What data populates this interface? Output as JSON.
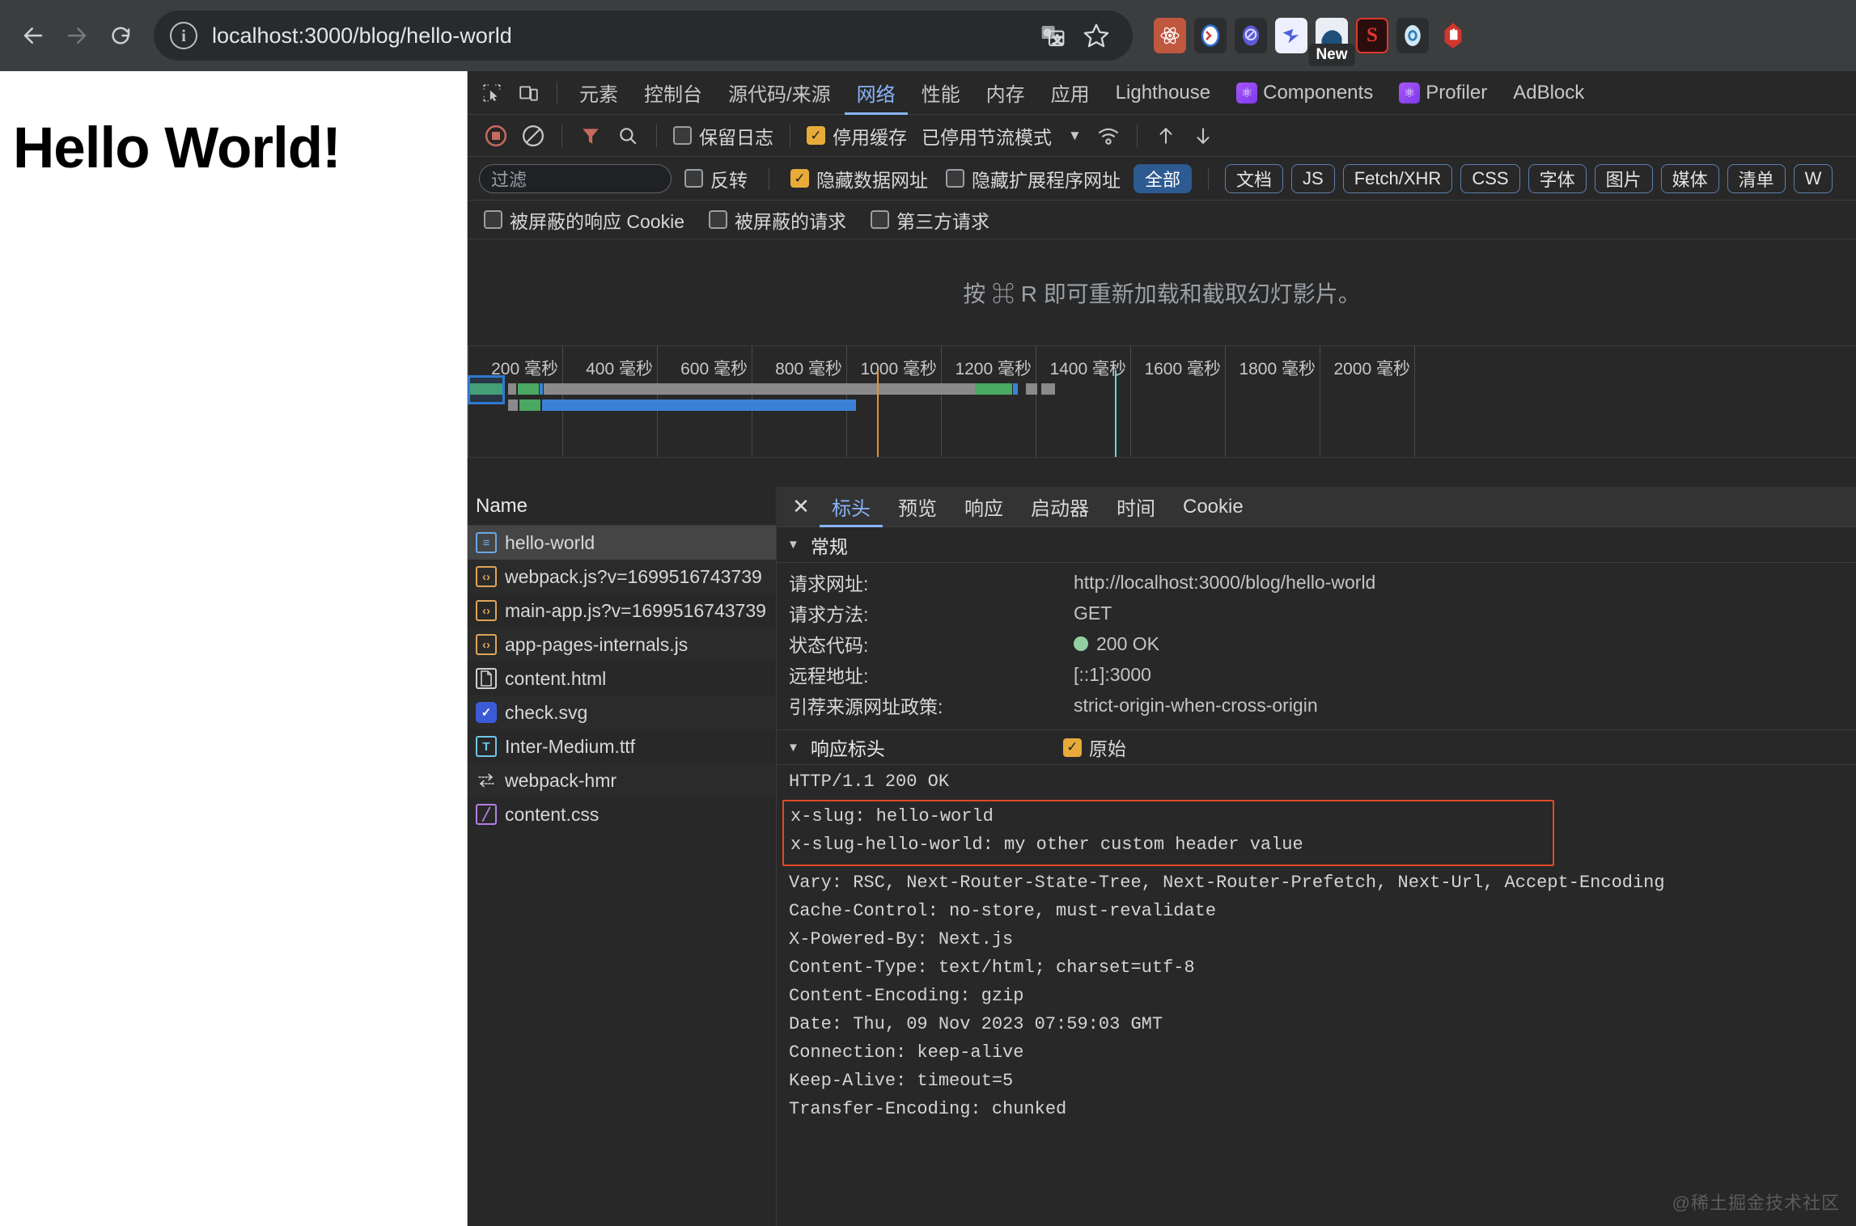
{
  "browser": {
    "back_icon": "arrow-left",
    "forward_icon": "arrow-right",
    "reload_icon": "reload",
    "site_info_icon": "info",
    "url": "localhost:3000/blog/hello-world",
    "translate_icon": "translate-icon",
    "bookmark_icon": "star-icon",
    "extensions": [
      {
        "name": "react-devtools-extension",
        "glyph": "⚛",
        "bg": "#c0573f",
        "color": "#ffffff"
      },
      {
        "name": "sync-extension",
        "glyph": "○",
        "bg": "#2b2d2f",
        "color": "#2f6fd0"
      },
      {
        "name": "circle-slash-extension",
        "glyph": "⊘",
        "bg": "#2b2d2f",
        "color": "#5a5ad6"
      },
      {
        "name": "bird-extension",
        "glyph": "➤",
        "bg": "#eef0ff",
        "color": "#4b63d8"
      },
      {
        "name": "wave-extension",
        "glyph": "◠",
        "bg": "#e9eef4",
        "color": "#1e4f7a",
        "badge": "New"
      },
      {
        "name": "s-extension",
        "glyph": "S",
        "bg": "#2a0d0d",
        "color": "#e0362c"
      },
      {
        "name": "o-extension",
        "glyph": "O",
        "bg": "#cfe7f5",
        "color": "#2b7fb8"
      },
      {
        "name": "adblock-hand-extension",
        "glyph": "✋",
        "bg": "#d0362c",
        "color": "#ffffff"
      }
    ]
  },
  "page": {
    "heading": "Hello World!"
  },
  "devtools": {
    "inspect_icon": "inspect-element-icon",
    "device_icon": "device-toolbar-icon",
    "tabs": [
      {
        "label": "元素",
        "active": false,
        "icon": null
      },
      {
        "label": "控制台",
        "active": false,
        "icon": null
      },
      {
        "label": "源代码/来源",
        "active": false,
        "icon": null
      },
      {
        "label": "网络",
        "active": true,
        "icon": null
      },
      {
        "label": "性能",
        "active": false,
        "icon": null
      },
      {
        "label": "内存",
        "active": false,
        "icon": null
      },
      {
        "label": "应用",
        "active": false,
        "icon": null
      },
      {
        "label": "Lighthouse",
        "active": false,
        "icon": null
      },
      {
        "label": "Components",
        "active": false,
        "icon": "react-badge"
      },
      {
        "label": "Profiler",
        "active": false,
        "icon": "react-badge"
      },
      {
        "label": "AdBlock",
        "active": false,
        "icon": null
      }
    ],
    "toolbar": {
      "record_icon": "record-stop-icon",
      "clear_icon": "clear-icon",
      "filter_icon": "funnel-icon",
      "search_icon": "search-icon",
      "preserve_log": {
        "label": "保留日志",
        "checked": false
      },
      "disable_cache": {
        "label": "停用缓存",
        "checked": true
      },
      "throttling": {
        "label": "已停用节流模式"
      },
      "wifi_icon": "network-conditions-icon",
      "import_icon": "import-har-icon",
      "export_icon": "export-har-icon"
    },
    "filterbar": {
      "filter_placeholder": "过滤",
      "invert": {
        "label": "反转",
        "checked": false
      },
      "hide_data_urls": {
        "label": "隐藏数据网址",
        "checked": true
      },
      "hide_ext_urls": {
        "label": "隐藏扩展程序网址",
        "checked": false
      },
      "type_chips": [
        {
          "label": "全部",
          "active": true
        },
        {
          "label": "文档",
          "active": false
        },
        {
          "label": "JS",
          "active": false
        },
        {
          "label": "Fetch/XHR",
          "active": false
        },
        {
          "label": "CSS",
          "active": false
        },
        {
          "label": "字体",
          "active": false
        },
        {
          "label": "图片",
          "active": false
        },
        {
          "label": "媒体",
          "active": false
        },
        {
          "label": "清单",
          "active": false
        },
        {
          "label": "W",
          "active": false
        }
      ]
    },
    "thirdbar": {
      "blocked_cookies": {
        "label": "被屏蔽的响应 Cookie",
        "checked": false
      },
      "blocked_requests": {
        "label": "被屏蔽的请求",
        "checked": false
      },
      "third_party": {
        "label": "第三方请求",
        "checked": false
      }
    },
    "filmstrip_message": "按 ⌘ R 即可重新加载和截取幻灯影片。",
    "timeline": {
      "ticks": [
        "200 毫秒",
        "400 毫秒",
        "600 毫秒",
        "800 毫秒",
        "1000 毫秒",
        "1200 毫秒",
        "1400 毫秒",
        "1600 毫秒",
        "1800 毫秒",
        "2000 毫秒"
      ]
    },
    "request_list": {
      "column_header": "Name",
      "rows": [
        {
          "name": "hello-world",
          "icon": "document-icon",
          "type": "doc",
          "selected": true
        },
        {
          "name": "webpack.js?v=1699516743739",
          "icon": "script-icon",
          "type": "js",
          "selected": false
        },
        {
          "name": "main-app.js?v=1699516743739",
          "icon": "script-icon",
          "type": "js",
          "selected": false
        },
        {
          "name": "app-pages-internals.js",
          "icon": "script-icon",
          "type": "js",
          "selected": false
        },
        {
          "name": "content.html",
          "icon": "page-icon",
          "type": "html",
          "selected": false
        },
        {
          "name": "check.svg",
          "icon": "image-icon",
          "type": "svg",
          "selected": false
        },
        {
          "name": "Inter-Medium.ttf",
          "icon": "font-icon",
          "type": "font",
          "selected": false
        },
        {
          "name": "webpack-hmr",
          "icon": "websocket-icon",
          "type": "ws",
          "selected": false
        },
        {
          "name": "content.css",
          "icon": "stylesheet-icon",
          "type": "css",
          "selected": false
        }
      ]
    },
    "detail": {
      "close_icon": "close-icon",
      "tabs": [
        {
          "label": "标头",
          "active": true
        },
        {
          "label": "预览",
          "active": false
        },
        {
          "label": "响应",
          "active": false
        },
        {
          "label": "启动器",
          "active": false
        },
        {
          "label": "时间",
          "active": false
        },
        {
          "label": "Cookie",
          "active": false
        }
      ],
      "general": {
        "title": "常规",
        "rows": [
          {
            "key": "请求网址:",
            "value": "http://localhost:3000/blog/hello-world",
            "status": false
          },
          {
            "key": "请求方法:",
            "value": "GET",
            "status": false
          },
          {
            "key": "状态代码:",
            "value": "200 OK",
            "status": true
          },
          {
            "key": "远程地址:",
            "value": "[::1]:3000",
            "status": false
          },
          {
            "key": "引荐来源网址政策:",
            "value": "strict-origin-when-cross-origin",
            "status": false
          }
        ]
      },
      "response_headers": {
        "title": "响应标头",
        "raw_toggle": {
          "label": "原始",
          "checked": true
        },
        "status_line": "HTTP/1.1 200 OK",
        "highlighted": [
          "x-slug: hello-world",
          "x-slug-hello-world: my other custom header value"
        ],
        "lines": [
          "Vary: RSC, Next-Router-State-Tree, Next-Router-Prefetch, Next-Url, Accept-Encoding",
          "Cache-Control: no-store, must-revalidate",
          "X-Powered-By: Next.js",
          "Content-Type: text/html; charset=utf-8",
          "Content-Encoding: gzip",
          "Date: Thu, 09 Nov 2023 07:59:03 GMT",
          "Connection: keep-alive",
          "Keep-Alive: timeout=5",
          "Transfer-Encoding: chunked"
        ]
      }
    }
  },
  "watermark": "@稀土掘金技术社区",
  "colors": {
    "accent_blue": "#8ab4f8",
    "checkbox_orange": "#e8ab3a",
    "highlight_red": "#e04a28",
    "status_green": "#93cfa2",
    "chip_active": "#2d5a91"
  }
}
